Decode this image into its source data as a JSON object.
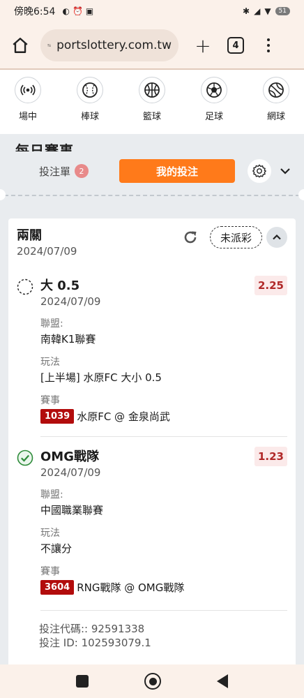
{
  "statusbar": {
    "time": "傍晚6:54",
    "battery": "51"
  },
  "browser": {
    "url": "portslottery.com.tw",
    "tab_count": "4"
  },
  "sports": [
    {
      "label": "場中",
      "icon": "live-broadcast-icon"
    },
    {
      "label": "棒球",
      "icon": "baseball-icon"
    },
    {
      "label": "籃球",
      "icon": "basketball-icon"
    },
    {
      "label": "足球",
      "icon": "soccer-ball-icon"
    },
    {
      "label": "網球",
      "icon": "tennis-ball-icon"
    }
  ],
  "behind_title": "每日賽事",
  "betslip": {
    "slip_label": "投注單",
    "slip_count": "2",
    "mybets_label": "我的投注"
  },
  "ticket": {
    "title": "兩關",
    "date": "2024/07/09",
    "status": "未派彩",
    "legs": [
      {
        "name": "大 0.5",
        "date": "2024/07/09",
        "odds": "2.25",
        "state": "pending",
        "league_label": "聯盟:",
        "league": "南韓K1聯賽",
        "market_label": "玩法",
        "market": "[上半場] 水原FC 大小 0.5",
        "event_label": "賽事",
        "event_id": "1039",
        "event": "水原FC @ 金泉尚武"
      },
      {
        "name": "OMG戰隊",
        "date": "2024/07/09",
        "odds": "1.23",
        "state": "won",
        "league_label": "聯盟:",
        "league": "中國職業聯賽",
        "market_label": "玩法",
        "market": "不讓分",
        "event_label": "賽事",
        "event_id": "3604",
        "event": "RNG戰隊 @ OMG戰隊"
      }
    ],
    "code_line": "投注代碼:: 92591338",
    "id_line": "投注 ID: 102593079.1"
  },
  "colors": {
    "accent": "#ff7a1a",
    "odds": "#b02828",
    "event_id_bg": "#b20c0c",
    "won": "#2e8b3a"
  }
}
